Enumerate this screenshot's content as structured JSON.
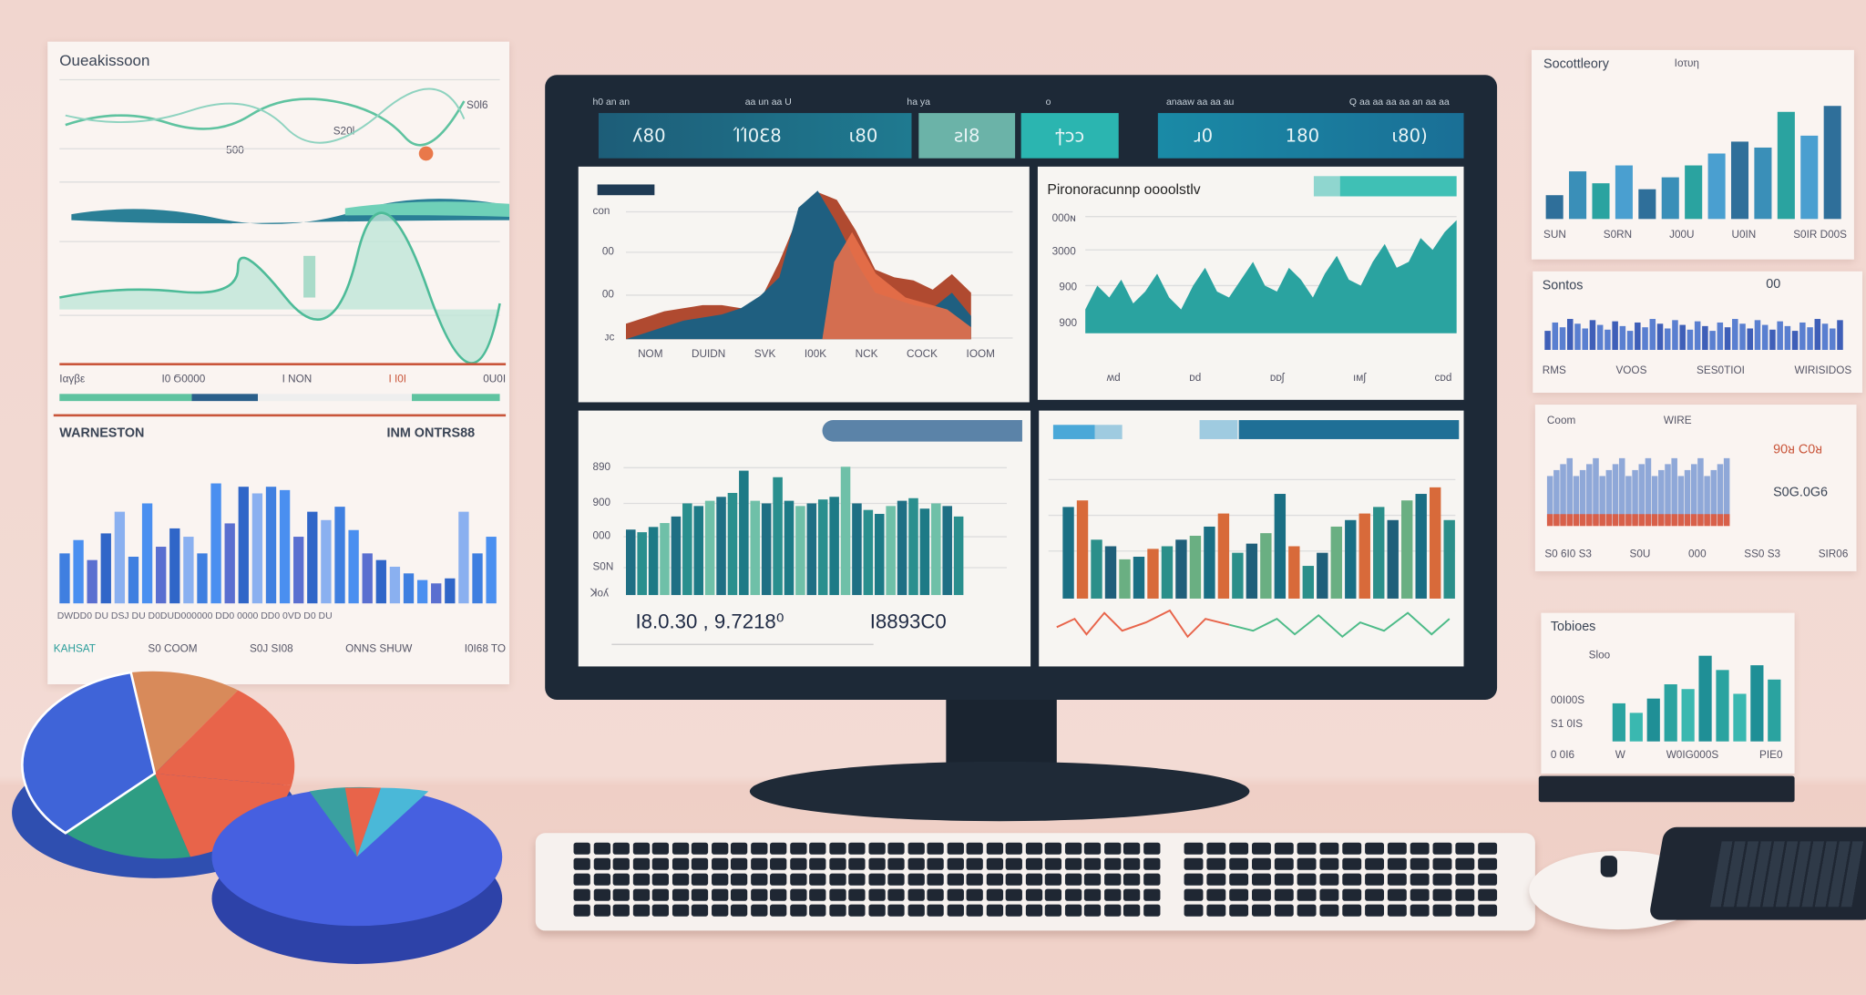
{
  "left_card": {
    "title": "Oueakissoon",
    "labels": [
      "S0l6",
      "S20l",
      "500"
    ],
    "legend": [
      "Ιαγβε",
      "Ι0 Ϭ0000",
      "Ι ΝΟΝ",
      "Ι Ι0Ι",
      "0U0Ι"
    ],
    "bar_title": "WARNESTON",
    "bar_subtitle": "INM ONTRS88",
    "bar_axis": "DWDD0 DU DSJ DU D0DUD000000 DD0 0000 DD0 0VD D0 DU",
    "footer": [
      "KAHSAT",
      "S0 COOM",
      "S0J SI08",
      "ONNS SHUW",
      "I0I68 TO"
    ],
    "bar_values": [
      30,
      38,
      26,
      42,
      55,
      28,
      60,
      34,
      45,
      40,
      30,
      72,
      48,
      70,
      66,
      70,
      68,
      40,
      55,
      50,
      58,
      44,
      30,
      26,
      22,
      18,
      14,
      12,
      15,
      55,
      30,
      40
    ]
  },
  "monitor": {
    "header": [
      "h0 an an",
      "aa un aa U",
      "ha ya",
      "o",
      "anaaw aa aa au",
      "Q aa aa aa aa an aa aa"
    ],
    "kpis": [
      "ʎ80",
      "ΊΊ0Ɛ8",
      "ι80",
      "ƨI8",
      "ϯᴐᴐ",
      "ɹ0",
      "180",
      "ι80)"
    ],
    "panel_a": {
      "yticks": [
        "ᴄon",
        "00",
        "00",
        "ᴊᴄ"
      ],
      "xticks": [
        "NOM",
        "DUIDN",
        "SVK",
        "I00K",
        "NCK",
        "COCK",
        "IOOM"
      ],
      "series1": [
        10,
        14,
        18,
        20,
        22,
        22,
        20,
        25,
        50,
        80,
        95,
        90,
        70,
        45,
        40,
        38,
        32,
        42,
        30
      ],
      "series2": [
        0,
        4,
        8,
        12,
        14,
        16,
        20,
        28,
        40,
        85,
        96,
        75,
        50,
        30,
        26,
        22,
        20,
        30,
        15
      ]
    },
    "panel_b": {
      "title": "Pironoracunnp oooolstlv",
      "yticks": [
        "000ɴ",
        "3000",
        "900",
        "900"
      ],
      "xticks": [
        "ʍd",
        "ᴅd",
        "ᴅᴅʃ",
        "ıᴍʃ",
        "ᴄᴅd"
      ],
      "values": [
        20,
        40,
        30,
        45,
        25,
        35,
        50,
        30,
        20,
        40,
        55,
        35,
        30,
        45,
        60,
        40,
        35,
        55,
        45,
        30,
        50,
        65,
        45,
        40,
        60,
        75,
        55,
        60,
        80,
        70,
        85,
        95
      ]
    },
    "panel_c": {
      "yticks": [
        "890",
        "900",
        "000",
        "S0N",
        "ꓘoʎ"
      ],
      "numbers": [
        "I8.0.30 , 9.7218⁰",
        "I8893C0"
      ],
      "values": [
        50,
        48,
        52,
        55,
        60,
        70,
        68,
        72,
        75,
        78,
        95,
        72,
        70,
        90,
        72,
        68,
        70,
        73,
        75,
        98,
        70,
        65,
        62,
        68,
        72,
        74,
        66,
        70,
        68,
        60
      ]
    },
    "panel_d": {
      "values": [
        70,
        75,
        45,
        40,
        30,
        32,
        38,
        40,
        45,
        48,
        55,
        65,
        35,
        42,
        50,
        80,
        40,
        25,
        35,
        55,
        60,
        65,
        70,
        60,
        75,
        80,
        85,
        60
      ],
      "colors": [
        "#1a6f84",
        "#d86a3a",
        "#2b8f8a",
        "#1f5f7a",
        "#6aaf82"
      ]
    }
  },
  "right_cards": [
    {
      "title": "Socottleory",
      "subtitle": "Ιοτυη",
      "xticks": [
        "SUN",
        "S0RN",
        "J00U",
        "U0IN",
        "S0IR D00S"
      ],
      "values": [
        20,
        40,
        30,
        45,
        25,
        35,
        45,
        55,
        65,
        60,
        90,
        70,
        95
      ]
    },
    {
      "title": "Sontos",
      "badge": "00",
      "xticks": [
        "RMS",
        "VOOS",
        "SES0TIOI",
        "WIRISIDOS"
      ]
    },
    {
      "title": "Coom",
      "subtitle": "WIRE",
      "labels": [
        "90ᴚ C0ᴚ",
        "S0G.0G6"
      ],
      "xticks": [
        "S0 6I0 S3",
        "S0U",
        "000",
        "SS0 S3",
        "SIR06"
      ]
    },
    {
      "title": "Tobioes",
      "labels": [
        "Sloo",
        "00I00S",
        "S1 0IS"
      ],
      "xticks": [
        "0 0I6",
        "W",
        "W0IG000S",
        "PIE0"
      ],
      "values": [
        40,
        30,
        45,
        60,
        55,
        90,
        75,
        50,
        80,
        65
      ]
    }
  ],
  "colors": {
    "background": "#f2d8d1",
    "monitor": "#1d2937",
    "teal": "#2a9d9a",
    "navy": "#1f5f7a",
    "orange": "#d86a3a",
    "blue": "#3f6fd6"
  }
}
